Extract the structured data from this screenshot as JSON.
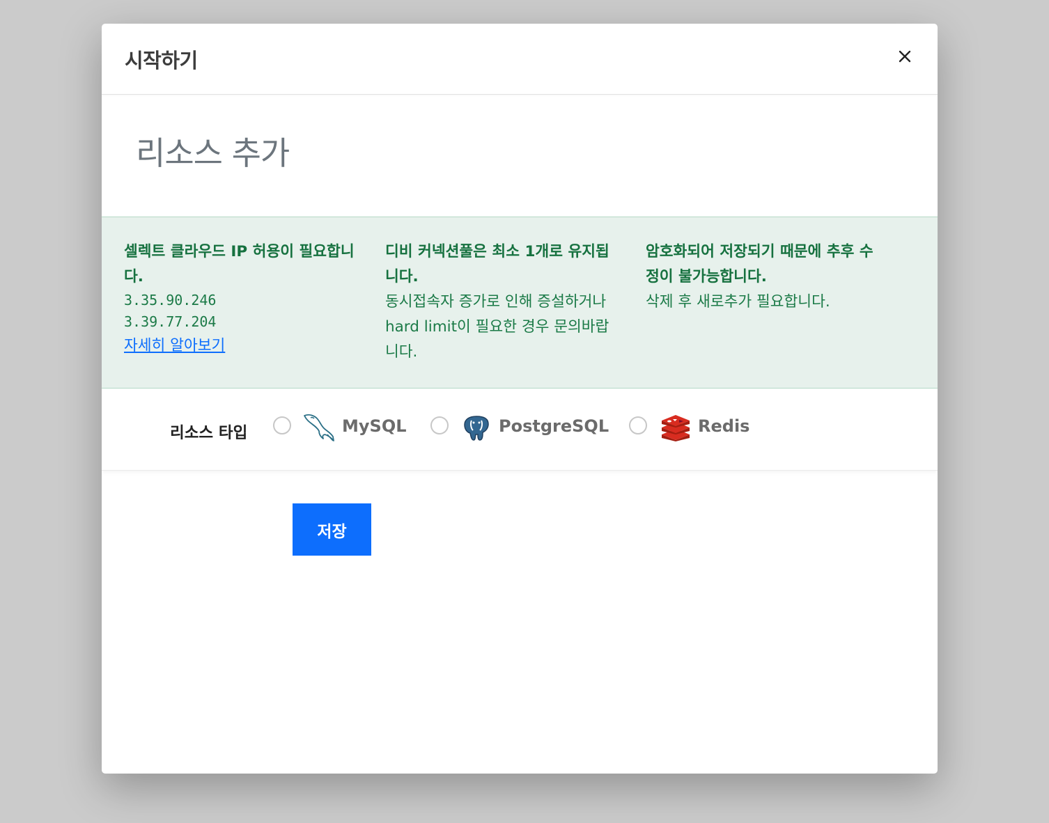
{
  "modal": {
    "title": "시작하기",
    "close_icon": "close-icon"
  },
  "page": {
    "heading": "리소스 추가"
  },
  "info": {
    "ip_notice": {
      "title": "셀렉트 클라우드 IP 허용이 필요합니다.",
      "ips": [
        "3.35.90.246",
        "3.39.77.204"
      ],
      "link_label": "자세히 알아보기"
    },
    "pool_notice": {
      "title": "디비 커넥션풀은 최소 1개로 유지됩니다.",
      "body": "동시접속자 증가로 인해 증설하거나 hard limit이 필요한 경우 문의바랍니다."
    },
    "encrypt_notice": {
      "title": "암호화되어 저장되기 때문에 추후 수정이 불가능합니다.",
      "body": "삭제 후 새로추가 필요합니다."
    },
    "colors": {
      "background": "#e7f1ec",
      "text": "#1b7a47",
      "link": "#0d6efd"
    }
  },
  "resource_type": {
    "label": "리소스 타입",
    "options": [
      {
        "name": "MySQL",
        "icon": "mysql-dolphin-icon",
        "selected": false
      },
      {
        "name": "PostgreSQL",
        "icon": "postgresql-elephant-icon",
        "selected": false
      },
      {
        "name": "Redis",
        "icon": "redis-icon",
        "selected": false
      }
    ]
  },
  "actions": {
    "save_label": "저장",
    "save_color": "#0d6efd"
  }
}
